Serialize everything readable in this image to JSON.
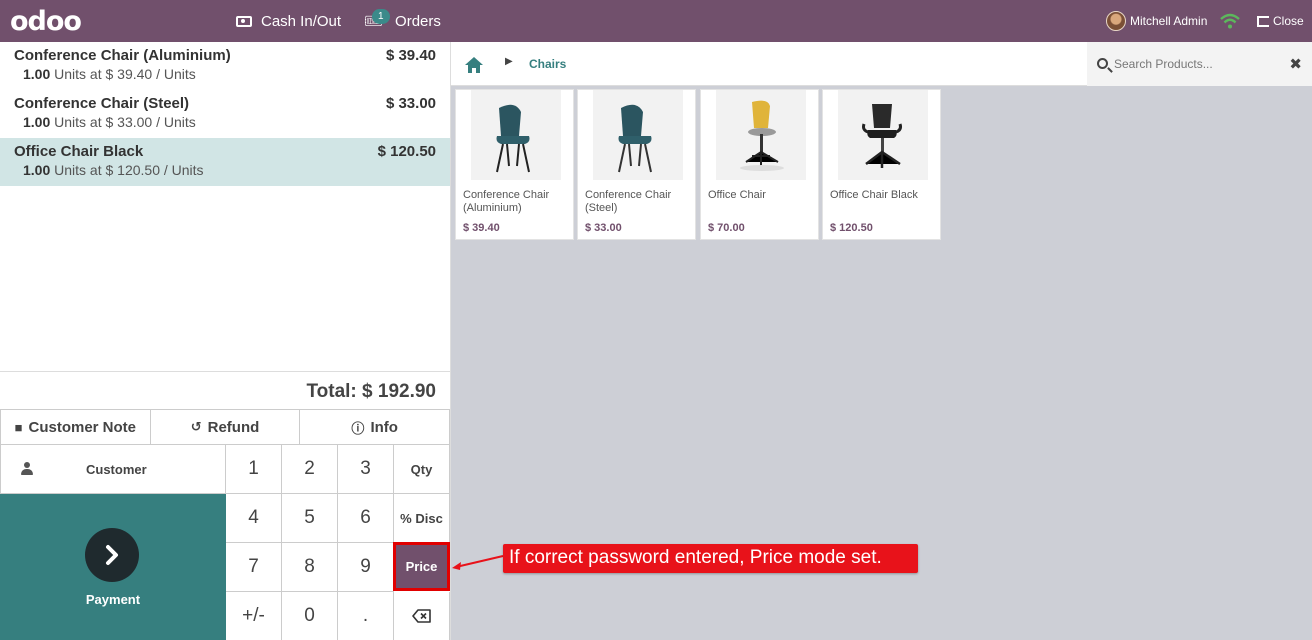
{
  "topbar": {
    "logo": "odoo",
    "cash_label": "Cash In/Out",
    "orders_label": "Orders",
    "orders_badge": "1",
    "user_name": "Mitchell Admin",
    "close_label": "Close"
  },
  "order": {
    "lines": [
      {
        "name": "Conference Chair (Aluminium)",
        "price": "$ 39.40",
        "qty": "1.00",
        "detail": " Units at $ 39.40 / Units",
        "selected": false
      },
      {
        "name": "Conference Chair (Steel)",
        "price": "$ 33.00",
        "qty": "1.00",
        "detail": " Units at $ 33.00 / Units",
        "selected": false
      },
      {
        "name": "Office Chair Black",
        "price": "$ 120.50",
        "qty": "1.00",
        "detail": " Units at $ 120.50 / Units",
        "selected": true
      }
    ],
    "total": "Total: $ 192.90"
  },
  "controls": {
    "customer_note": "Customer Note",
    "refund": "Refund",
    "info": "Info",
    "customer": "Customer",
    "payment": "Payment"
  },
  "numpad": {
    "keys": [
      "1",
      "2",
      "3",
      "4",
      "5",
      "6",
      "7",
      "8",
      "9",
      "+/-",
      "0",
      "."
    ],
    "modes": [
      "Qty",
      "% Disc",
      "Price"
    ],
    "active_mode": "Price"
  },
  "breadcrumb": {
    "category": "Chairs"
  },
  "search": {
    "placeholder": "Search Products..."
  },
  "products": [
    {
      "name": "Conference Chair (Aluminium)",
      "price": "$ 39.40"
    },
    {
      "name": "Conference Chair (Steel)",
      "price": "$ 33.00"
    },
    {
      "name": "Office Chair",
      "price": "$ 70.00"
    },
    {
      "name": "Office Chair Black",
      "price": "$ 120.50"
    }
  ],
  "annotation": "If correct password entered, Price mode set.",
  "colors": {
    "brand": "#71506c",
    "accent": "#367f7f",
    "highlight": "#e8121a"
  }
}
